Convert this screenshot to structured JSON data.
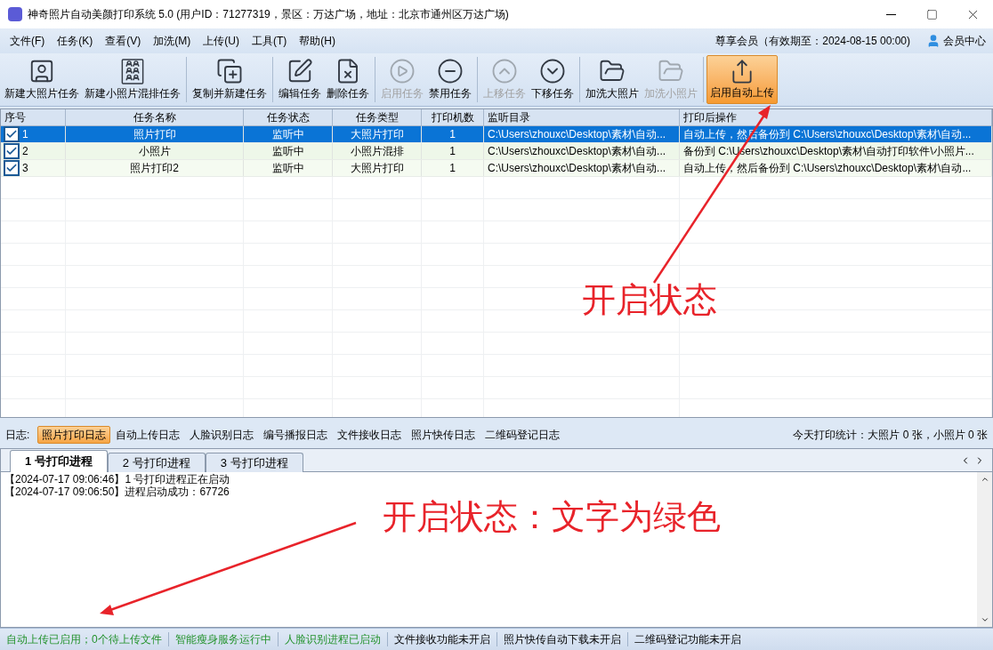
{
  "window": {
    "title": "神奇照片自动美颜打印系统 5.0 (用户ID：71277319，景区：万达广场，地址：北京市通州区万达广场)"
  },
  "menu": [
    "文件(F)",
    "任务(K)",
    "查看(V)",
    "加洗(M)",
    "上传(U)",
    "工具(T)",
    "帮助(H)"
  ],
  "membership": {
    "text": "尊享会员（有效期至：2024-08-15 00:00)",
    "link": "会员中心"
  },
  "toolbar": [
    {
      "label": "新建大照片任务",
      "disabled": false,
      "active": false,
      "group_start": false
    },
    {
      "label": "新建小照片混排任务",
      "disabled": false,
      "active": false,
      "group_start": false
    },
    {
      "label": "复制并新建任务",
      "disabled": false,
      "active": false,
      "group_start": true
    },
    {
      "label": "编辑任务",
      "disabled": false,
      "active": false,
      "group_start": true
    },
    {
      "label": "删除任务",
      "disabled": false,
      "active": false,
      "group_start": false
    },
    {
      "label": "启用任务",
      "disabled": true,
      "active": false,
      "group_start": true
    },
    {
      "label": "禁用任务",
      "disabled": false,
      "active": false,
      "group_start": false
    },
    {
      "label": "上移任务",
      "disabled": true,
      "active": false,
      "group_start": true
    },
    {
      "label": "下移任务",
      "disabled": false,
      "active": false,
      "group_start": false
    },
    {
      "label": "加洗大照片",
      "disabled": false,
      "active": false,
      "group_start": true
    },
    {
      "label": "加洗小照片",
      "disabled": true,
      "active": false,
      "group_start": false
    },
    {
      "label": "启用自动上传",
      "disabled": false,
      "active": true,
      "group_start": true
    }
  ],
  "table": {
    "columns": [
      "序号",
      "任务名称",
      "任务状态",
      "任务类型",
      "打印机数",
      "监听目录",
      "打印后操作"
    ],
    "rows": [
      {
        "checked": true,
        "selected": true,
        "cells": [
          "1",
          "照片打印",
          "监听中",
          "大照片打印",
          "1",
          "C:\\Users\\zhouxc\\Desktop\\素材\\自动...",
          "自动上传，然后备份到 C:\\Users\\zhouxc\\Desktop\\素材\\自动..."
        ]
      },
      {
        "checked": true,
        "selected": false,
        "cells": [
          "2",
          "小照片",
          "监听中",
          "小照片混排",
          "1",
          "C:\\Users\\zhouxc\\Desktop\\素材\\自动...",
          "备份到 C:\\Users\\zhouxc\\Desktop\\素材\\自动打印软件\\小照片..."
        ]
      },
      {
        "checked": true,
        "selected": false,
        "cells": [
          "3",
          "照片打印2",
          "监听中",
          "大照片打印",
          "1",
          "C:\\Users\\zhouxc\\Desktop\\素材\\自动...",
          "自动上传，然后备份到 C:\\Users\\zhouxc\\Desktop\\素材\\自动..."
        ]
      }
    ]
  },
  "log_bar": {
    "label": "日志:",
    "tabs": [
      {
        "label": "照片打印日志",
        "selected": true
      },
      {
        "label": "自动上传日志",
        "selected": false
      },
      {
        "label": "人脸识别日志",
        "selected": false
      },
      {
        "label": "编号播报日志",
        "selected": false
      },
      {
        "label": "文件接收日志",
        "selected": false
      },
      {
        "label": "照片快传日志",
        "selected": false
      },
      {
        "label": "二维码登记日志",
        "selected": false
      }
    ],
    "stats": "今天打印统计：大照片 0 张，小照片 0 张"
  },
  "process_tabs": [
    {
      "label": "1 号打印进程",
      "selected": true
    },
    {
      "label": "2 号打印进程",
      "selected": false
    },
    {
      "label": "3 号打印进程",
      "selected": false
    }
  ],
  "log_lines": [
    "【2024-07-17 09:06:46】1 号打印进程正在启动",
    "【2024-07-17 09:06:50】进程启动成功：67726"
  ],
  "status_bar": [
    {
      "text": "自动上传已启用；0个待上传文件",
      "on": true
    },
    {
      "text": "智能瘦身服务运行中",
      "on": true
    },
    {
      "text": "人脸识别进程已启动",
      "on": true
    },
    {
      "text": "文件接收功能未开启",
      "on": false
    },
    {
      "text": "照片快传自动下载未开启",
      "on": false
    },
    {
      "text": "二维码登记功能未开启",
      "on": false
    }
  ],
  "annotations": [
    "开启状态",
    "开启状态：文字为绿色"
  ]
}
